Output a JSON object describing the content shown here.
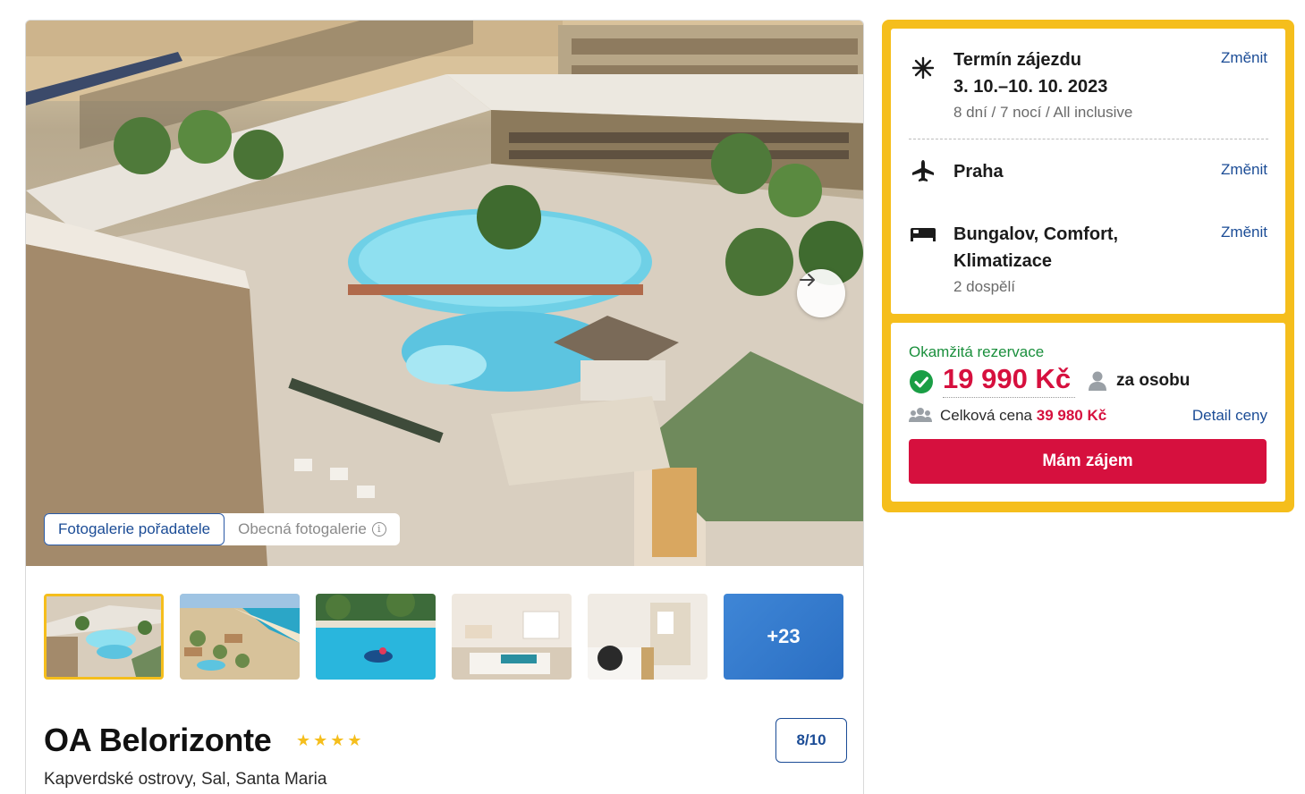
{
  "gallery": {
    "tabs": [
      {
        "label": "Fotogalerie pořadatele",
        "active": true
      },
      {
        "label": "Obecná fotogalerie",
        "active": false
      }
    ],
    "more_count": "+23",
    "next_icon": "arrow-right-icon"
  },
  "hotel": {
    "name": "OA Belorizonte",
    "stars": 4,
    "rating": "8/10",
    "location": "Kapverdské ostrovy, Sal, Santa Maria"
  },
  "booking": {
    "term_label": "Termín zájezdu",
    "term_dates": "3. 10.–10. 10. 2023",
    "term_details": "8 dní / 7 nocí / All inclusive",
    "departure": "Praha",
    "room_line1": "Bungalov, Comfort,",
    "room_line2": "Klimatizace",
    "travelers": "2 dospělí",
    "change_label": "Změnit",
    "instant_label": "Okamžitá rezervace",
    "price": "19 990 Kč",
    "per_person": "za osobu",
    "total_label": "Celková cena",
    "total_value": "39 980 Kč",
    "detail_label": "Detail ceny",
    "cta_label": "Mám zájem"
  },
  "colors": {
    "accent_yellow": "#f5be1c",
    "brand_red": "#d6103e",
    "link_blue": "#1b4c96",
    "success_green": "#1a8f3c"
  }
}
